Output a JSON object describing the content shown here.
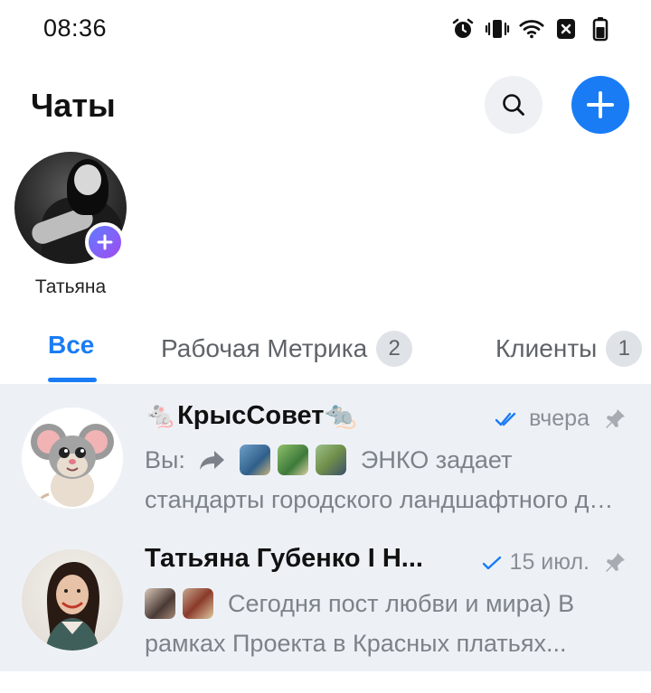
{
  "status_bar": {
    "time": "08:36",
    "icons": [
      "alarm-icon",
      "vibrate-icon",
      "wifi-icon",
      "sim-off-icon",
      "battery-icon"
    ]
  },
  "header": {
    "title": "Чаты",
    "search_icon": "search-icon",
    "add_icon": "plus-icon",
    "accent_color": "#1a7cf5"
  },
  "stories": [
    {
      "name": "Татьяна"
    }
  ],
  "tabs": [
    {
      "label": "Все",
      "badge": "",
      "active": true
    },
    {
      "label": "Рабочая Метрика",
      "badge": "2",
      "active": false
    },
    {
      "label": "Клиенты",
      "badge": "1",
      "active": false
    }
  ],
  "chats": [
    {
      "title": "🐁КрысСовет🐀",
      "time": "вчера",
      "read_status": "double-check",
      "pinned": true,
      "preview_prefix": "Вы:",
      "preview_line1": "ЭНКО задает",
      "preview_line2": "стандарты городского ландшафтного дизайна"
    },
    {
      "title": "Татьяна Губенко I Н...",
      "time": "15 июл.",
      "read_status": "single-check",
      "pinned": true,
      "preview_prefix": "",
      "preview_line1": "Сегодня пост любви и мира) В",
      "preview_line2": "рамках Проекта в Красных платьях..."
    }
  ]
}
